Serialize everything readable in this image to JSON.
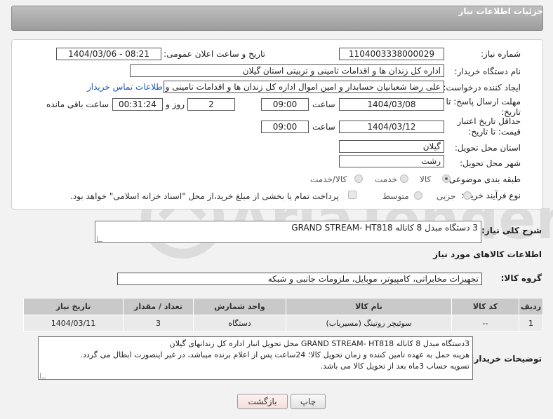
{
  "header": {
    "title": "جزئیات اطلاعات نیاز"
  },
  "form": {
    "need_number_label": "شماره نیاز:",
    "need_number_value": "1104003338000029",
    "announce_label": "تاریخ و ساعت اعلان عمومی:",
    "announce_value": "1404/03/06 - 08:21",
    "buyer_org_label": "نام دستگاه خریدار:",
    "buyer_org_value": "اداره کل زندان ها و اقدامات تامینی و تربیتی استان گیلان",
    "creator_label": "ایجاد کننده درخواست:",
    "creator_value": "علی رضا شعبانیان حسابدار و امین اموال اداره کل زندان ها و اقدامات تامینی و تر",
    "contact_link": "اطلاعات تماس خریدار",
    "reply_deadline_label": "مهلت ارسال پاسخ: تا تاریخ:",
    "reply_date": "1404/03/08",
    "time_label": "ساعت",
    "reply_time": "09:00",
    "days_value": "2",
    "days_label": "روز و",
    "remaining_value": "00:31:24",
    "remaining_label": "ساعت باقی مانده",
    "price_validity_label": "حداقل تاریخ اعتبار قیمت: تا تاریخ:",
    "price_date": "1404/03/12",
    "price_time": "09:00",
    "province_label": "استان محل تحویل:",
    "province_value": "گیلان",
    "city_label": "شهر محل تحویل:",
    "city_value": "رشت",
    "category_label": "طبقه بندی موضوعی:",
    "category_options": [
      "کالا",
      "خدمت",
      "کالا/خدمت"
    ],
    "category_selected": "کالا",
    "process_label": "نوع فرآیند خرید :",
    "process_options": [
      "جزیی",
      "متوسط"
    ],
    "payment_note": "پرداخت تمام یا بخشی از مبلغ خرید،از محل \"اسناد خزانه اسلامی\" خواهد بود."
  },
  "summary": {
    "label": "شرح کلی نیاز:",
    "value": "3 دستگاه مبدل 8 کاناله GRAND STREAM- HT818"
  },
  "goods": {
    "section_title": "اطلاعات کالاهای مورد نیاز",
    "group_label": "گروه کالا:",
    "group_value": "تجهیزات مخابراتی، کامپیوتر، موبایل، ملزومات جانبی و شبکه",
    "columns": [
      "ردیف",
      "کد کالا",
      "نام کالا",
      "واحد شمارش",
      "تعداد / مقدار",
      "تاریخ نیاز"
    ],
    "rows": [
      [
        "1",
        "--",
        "سوئیچر روتینگ (مسیریاب)",
        "دستگاه",
        "3",
        "1404/03/11"
      ]
    ]
  },
  "notes": {
    "label": "توضیحات خریدار:",
    "lines": [
      "3دستگاه مبدل 8 کاناله GRAND STREAM- HT818 محل تحویل انبار اداره کل زندانهای گیلان",
      "هزینه حمل به عهده تامین کننده و زمان تحویل کالا؛ 24ساعت پس از اعلام برنده میباشد، در غیر اینصورت ابطال می گردد.",
      "تسویه حساب 3ماه بعد از تحویل کالا می باشد."
    ]
  },
  "buttons": {
    "print": "چاپ",
    "back": "بازگشت"
  },
  "watermark": {
    "text": "AriaTender.net"
  }
}
